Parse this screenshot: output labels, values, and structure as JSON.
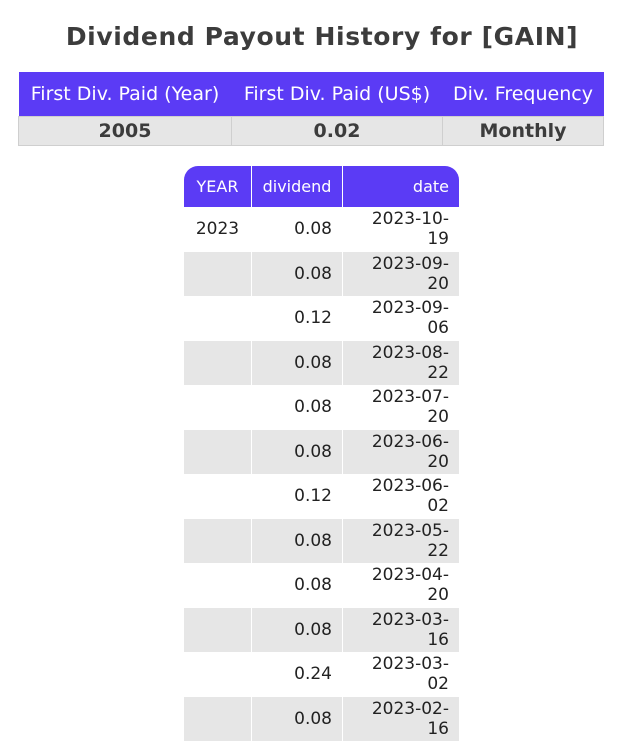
{
  "page": {
    "title": "Dividend Payout History for [GAIN]"
  },
  "summary": {
    "headers": [
      "First Div. Paid (Year)",
      "First Div. Paid (US$)",
      "Div. Frequency"
    ],
    "values": [
      "2005",
      "0.02",
      "Monthly"
    ]
  },
  "history": {
    "headers": {
      "year": "YEAR",
      "dividend": "dividend",
      "date": "date"
    },
    "rows": [
      {
        "year": "2023",
        "dividend": "0.08",
        "date": "2023-10-19"
      },
      {
        "year": "",
        "dividend": "0.08",
        "date": "2023-09-20"
      },
      {
        "year": "",
        "dividend": "0.12",
        "date": "2023-09-06"
      },
      {
        "year": "",
        "dividend": "0.08",
        "date": "2023-08-22"
      },
      {
        "year": "",
        "dividend": "0.08",
        "date": "2023-07-20"
      },
      {
        "year": "",
        "dividend": "0.08",
        "date": "2023-06-20"
      },
      {
        "year": "",
        "dividend": "0.12",
        "date": "2023-06-02"
      },
      {
        "year": "",
        "dividend": "0.08",
        "date": "2023-05-22"
      },
      {
        "year": "",
        "dividend": "0.08",
        "date": "2023-04-20"
      },
      {
        "year": "",
        "dividend": "0.08",
        "date": "2023-03-16"
      },
      {
        "year": "",
        "dividend": "0.24",
        "date": "2023-03-02"
      },
      {
        "year": "",
        "dividend": "0.08",
        "date": "2023-02-16"
      }
    ]
  },
  "colors": {
    "accent": "#5b3bf5",
    "row_shade": "#e6e6e6",
    "title_text": "#3c3c3c"
  }
}
